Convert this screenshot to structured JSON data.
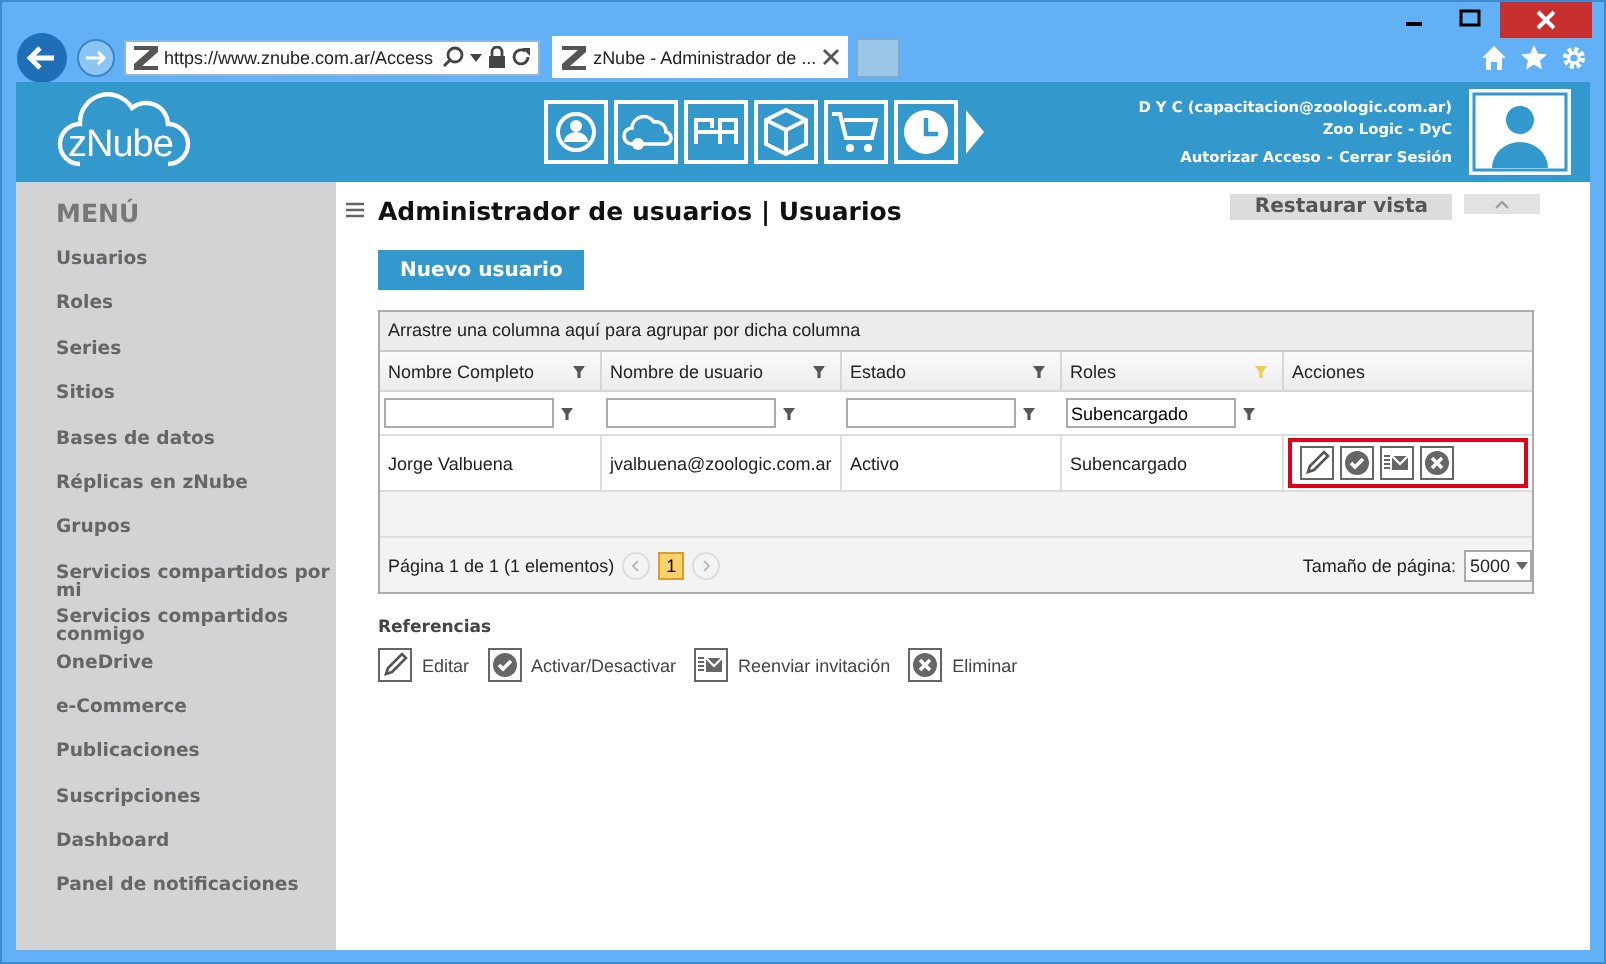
{
  "browser": {
    "url": "https://www.znube.com.ar/Access",
    "tab_title": "zNube - Administrador de ..."
  },
  "header": {
    "logo": "zNube",
    "user": "D Y C (capacitacion@zoologic.com.ar)",
    "company": "Zoo Logic - DyC",
    "links": [
      "Autorizar Acceso",
      "Cerrar Sesión"
    ],
    "link_separator": "-"
  },
  "sidebar": {
    "title": "MENÚ",
    "items": [
      {
        "label": "Usuarios"
      },
      {
        "label": "Roles"
      },
      {
        "label": "Series"
      },
      {
        "label": "Sitios"
      },
      {
        "label": "Bases de datos"
      },
      {
        "label": "Réplicas en zNube"
      },
      {
        "label": "Grupos"
      },
      {
        "label": "Servicios compartidos por mi"
      },
      {
        "label": "Servicios compartidos conmigo"
      },
      {
        "label": "OneDrive"
      },
      {
        "label": "e-Commerce"
      },
      {
        "label": "Publicaciones"
      },
      {
        "label": "Suscripciones"
      },
      {
        "label": "Dashboard"
      },
      {
        "label": "Panel de notificaciones"
      }
    ]
  },
  "page": {
    "title": "Administrador de usuarios | Usuarios",
    "restore_button": "Restaurar vista",
    "new_button": "Nuevo usuario"
  },
  "grid": {
    "group_hint": "Arrastre una columna aquí para agrupar por dicha columna",
    "columns": [
      {
        "label": "Nombre Completo",
        "filtered": false,
        "kind": "text"
      },
      {
        "label": "Nombre de usuario",
        "filtered": false,
        "kind": "text"
      },
      {
        "label": "Estado",
        "filtered": false,
        "kind": "text"
      },
      {
        "label": "Roles",
        "filtered": true,
        "kind": "text",
        "filter_value": "Subencargado"
      },
      {
        "label": "Acciones",
        "kind": "actions"
      }
    ],
    "rows": [
      {
        "cells": [
          "Jorge Valbuena",
          "jvalbuena@zoologic.com.ar",
          "Activo",
          "Subencargado"
        ],
        "actions": [
          {
            "kind": "edit"
          },
          {
            "kind": "toggle"
          },
          {
            "kind": "resend"
          },
          {
            "kind": "delete"
          }
        ],
        "actions_highlighted": true
      }
    ],
    "pager": {
      "summary": "Página 1 de 1 (1 elementos)",
      "pages": [
        {
          "label": "1",
          "selected": true
        }
      ],
      "page_size_label": "Tamaño de página:",
      "page_size": "5000"
    }
  },
  "references": {
    "title": "Referencias",
    "items": [
      {
        "kind": "edit",
        "label": "Editar"
      },
      {
        "kind": "toggle",
        "label": "Activar/Desactivar"
      },
      {
        "kind": "resend",
        "label": "Reenviar invitación"
      },
      {
        "kind": "delete",
        "label": "Eliminar"
      }
    ]
  }
}
